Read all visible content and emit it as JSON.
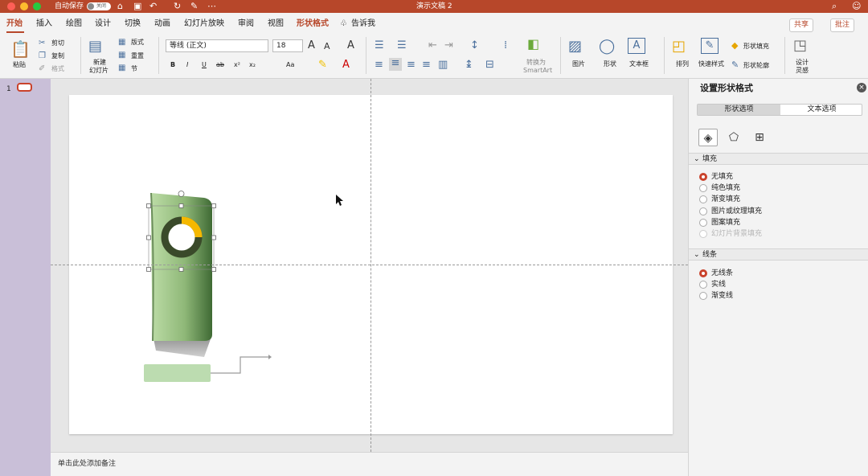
{
  "window": {
    "title": "演示文稿 2",
    "autosave_label": "自动保存",
    "autosave_state": "关闭",
    "traffic_colors": [
      "#fe5f57",
      "#febc2e",
      "#28c840"
    ]
  },
  "tabs": [
    "开始",
    "插入",
    "绘图",
    "设计",
    "切换",
    "动画",
    "幻灯片放映",
    "审阅",
    "视图",
    "形状格式"
  ],
  "tell_me": "告诉我",
  "share_label": "共享",
  "comment_label": "批注",
  "ribbon": {
    "paste": "粘贴",
    "cut": "剪切",
    "copy": "复制",
    "format": "格式",
    "new_slide_1": "新建",
    "new_slide_2": "幻灯片",
    "layout": "版式",
    "reset": "重置",
    "section": "节",
    "font_name": "等线 (正文)",
    "font_size": "18",
    "bold": "B",
    "italic": "I",
    "underline": "U",
    "strike": "ab",
    "superscript": "x²",
    "subscript": "x₂",
    "font_case": "Aa",
    "convert_smartart_1": "转换为",
    "convert_smartart_2": "SmartArt",
    "picture": "图片",
    "shape": "形状",
    "textbox": "文本框",
    "arrange": "排列",
    "quick_styles": "快速样式",
    "shape_fill": "形状填充",
    "shape_outline": "形状轮廓",
    "designer_1": "设计",
    "designer_2": "灵感"
  },
  "thumbnails": {
    "slide_number": "1"
  },
  "notes_placeholder": "单击此处添加备注",
  "panel": {
    "title": "设置形状格式",
    "tabs": [
      "形状选项",
      "文本选项"
    ],
    "fill_section": "填充",
    "fill_options": [
      "无填充",
      "纯色填充",
      "渐变填充",
      "图片或纹理填充",
      "图案填充",
      "幻灯片背景填充"
    ],
    "line_section": "线条",
    "line_options": [
      "无线条",
      "实线",
      "渐变线"
    ]
  },
  "colors": {
    "accent": "#b7472a",
    "shape_green_light": "#a9cf92",
    "shape_green_dark": "#3f6a34",
    "ring_dark": "#3a4a2a",
    "ring_accent": "#f5b800",
    "label_box": "#bcdcb0"
  }
}
